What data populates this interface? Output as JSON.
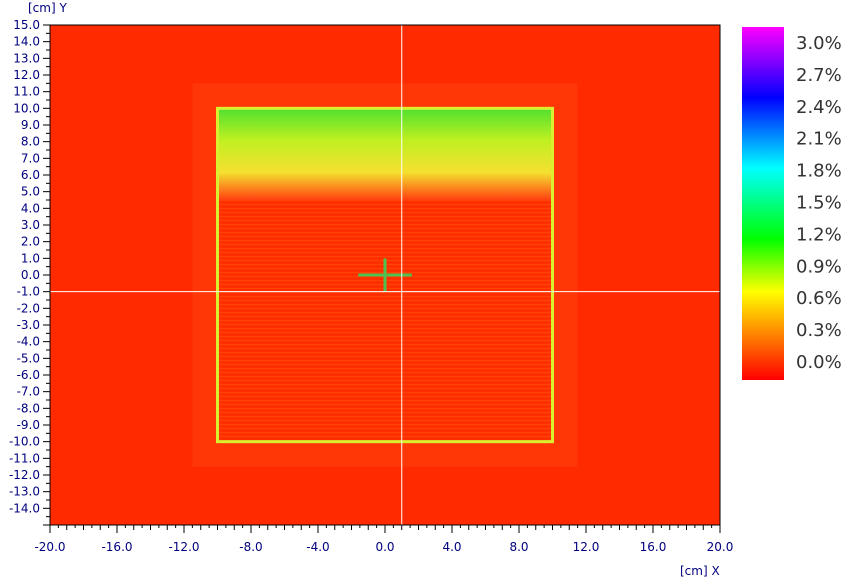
{
  "chart_data": {
    "type": "heatmap",
    "title": "",
    "xlabel": "[cm] X",
    "ylabel": "[cm] Y",
    "xlim": [
      -20.0,
      20.0
    ],
    "ylim": [
      -15.0,
      15.0
    ],
    "x_ticks": [
      "-20.0",
      "-16.0",
      "-12.0",
      "-8.0",
      "-4.0",
      "0.0",
      "4.0",
      "8.0",
      "12.0",
      "16.0",
      "20.0"
    ],
    "x_tick_values": [
      -20,
      -16,
      -12,
      -8,
      -4,
      0,
      4,
      8,
      12,
      16,
      20
    ],
    "y_ticks": [
      "15.0",
      "14.0",
      "13.0",
      "12.0",
      "11.0",
      "10.0",
      "9.0",
      "8.0",
      "7.0",
      "6.0",
      "5.0",
      "4.0",
      "3.0",
      "2.0",
      "1.0",
      "0.0",
      "-1.0",
      "-2.0",
      "-3.0",
      "-4.0",
      "-5.0",
      "-6.0",
      "-7.0",
      "-8.0",
      "-9.0",
      "-10.0",
      "-11.0",
      "-12.0",
      "-13.0",
      "-14.0"
    ],
    "y_tick_values": [
      15,
      14,
      13,
      12,
      11,
      10,
      9,
      8,
      7,
      6,
      5,
      4,
      3,
      2,
      1,
      0,
      -1,
      -2,
      -3,
      -4,
      -5,
      -6,
      -7,
      -8,
      -9,
      -10,
      -11,
      -12,
      -13,
      -14
    ],
    "colorbar": {
      "labels": [
        "3.0%",
        "2.7%",
        "2.4%",
        "2.1%",
        "1.8%",
        "1.5%",
        "1.2%",
        "0.9%",
        "0.6%",
        "0.3%",
        "0.0%"
      ],
      "values": [
        3.0,
        2.7,
        2.4,
        2.1,
        1.8,
        1.5,
        1.2,
        0.9,
        0.6,
        0.3,
        0.0
      ],
      "colors": [
        "#ff00ff",
        "#a000d8",
        "#0000ff",
        "#0060ff",
        "#00b0ff",
        "#00ffff",
        "#00e000",
        "#80ff00",
        "#ffff00",
        "#ffa000",
        "#ff0000"
      ]
    },
    "field": {
      "background_value": 0.1,
      "square_x": [
        -10.0,
        10.0
      ],
      "square_y": [
        -10.0,
        10.0
      ],
      "square_interior_value": 0.15,
      "top_band_y": [
        4.5,
        10.0
      ],
      "top_band_value_at_top": 0.95,
      "top_band_value_at_bottom": 0.4,
      "edge_value": 0.6
    },
    "crosshair": {
      "x": 1.0,
      "y": -1.0
    },
    "center_marker": {
      "x": 0.0,
      "y": 0.0,
      "half_width": 1.6,
      "half_height": 1.0
    }
  }
}
